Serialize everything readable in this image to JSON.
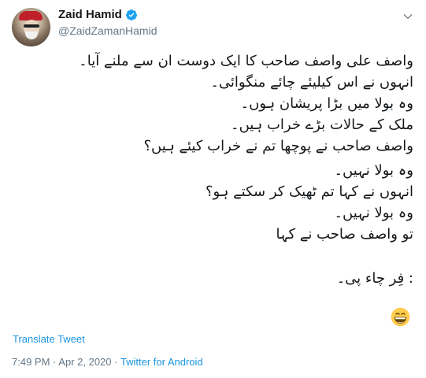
{
  "tweet": {
    "author": {
      "display_name": "Zaid Hamid",
      "handle": "@ZaidZamanHamid",
      "verified": true
    },
    "lines": [
      "واصف علی واصف صاحب کا ایک دوست ان سے ملنے آیا۔",
      "انہوں نے اس کیلیئے چائے منگوائی۔",
      "وہ بولا میں بڑا پریشان ہوں۔",
      "ملک کے حالات بڑے خراب ہیں۔",
      "واصف صاحب نے پوچھا تم نے خراب کیئے ہیں؟",
      "وہ بولا نہیں۔",
      "انہوں نے کہا تم ٹھیک کر سکتے ہو؟",
      "وہ بولا نہیں۔",
      "تو واصف صاحب نے کہا",
      "",
      ": فِر چاء پی۔"
    ],
    "emoji": "grinning-face-icon",
    "translate_label": "Translate Tweet",
    "time": "7:49 PM",
    "separator": "·",
    "date": "Apr 2, 2020",
    "source": "Twitter for Android"
  },
  "colors": {
    "link": "#1b95e0",
    "verified": "#1da1f2",
    "muted": "#657786",
    "text": "#14171a"
  }
}
